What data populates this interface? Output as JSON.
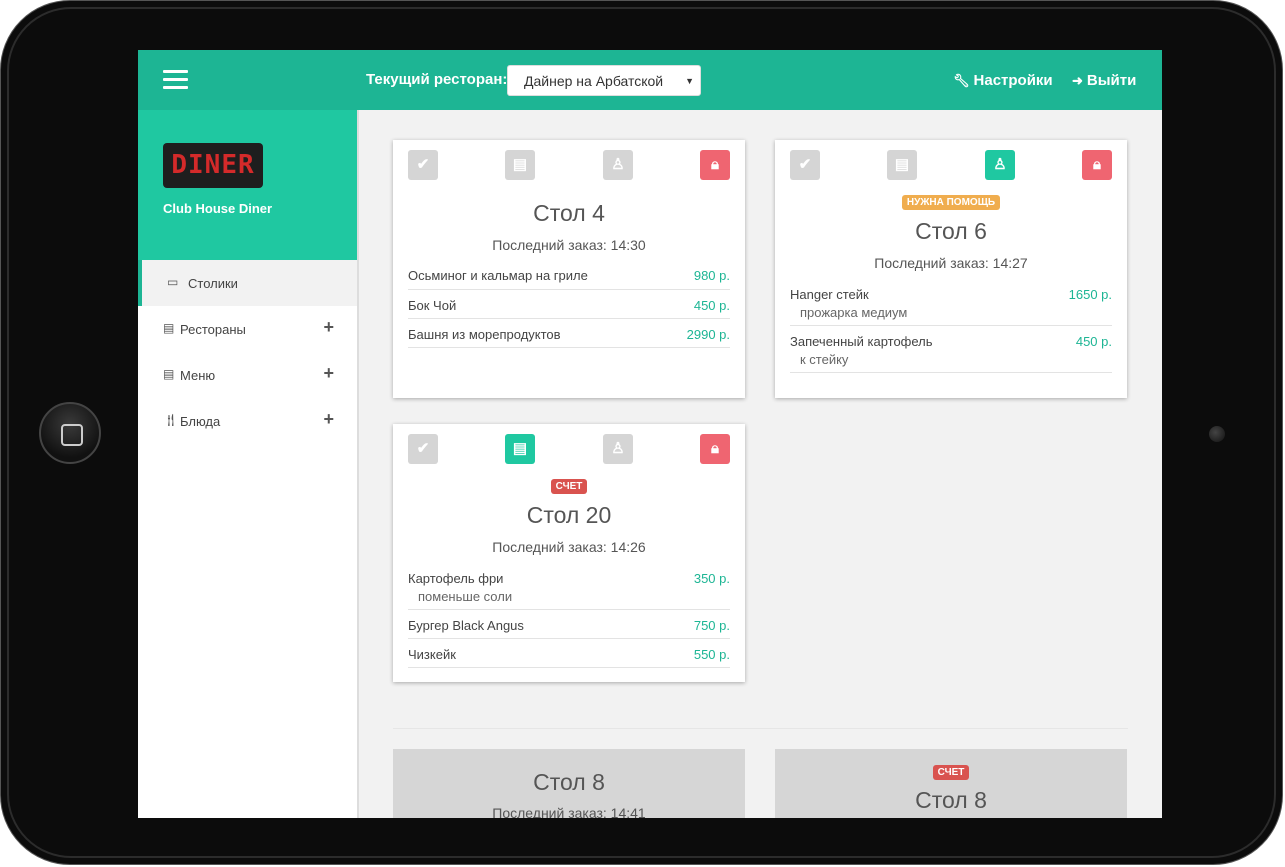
{
  "header": {
    "restaurant_label": "Текущий ресторан:",
    "restaurant_selected": "Дайнер на Арбатской",
    "settings_label": "Настройки",
    "logout_label": "Выйти"
  },
  "sidebar": {
    "logo_text": "DINER",
    "brand_name": "Club House Diner",
    "items": [
      {
        "label": "Столики"
      },
      {
        "label": "Рестораны"
      },
      {
        "label": "Меню"
      },
      {
        "label": "Блюда"
      }
    ]
  },
  "cards": [
    {
      "title": "Стол 4",
      "last_order": "Последний заказ: 14:30",
      "items": [
        {
          "name": "Осьминог и кальмар на гриле",
          "price": "980 р."
        },
        {
          "name": "Бок Чой",
          "price": "450 р."
        },
        {
          "name": "Башня из морепродуктов",
          "price": "2990 р."
        }
      ]
    },
    {
      "badge": "НУЖНА ПОМОЩЬ",
      "title": "Стол 6",
      "last_order": "Последний заказ: 14:27",
      "items": [
        {
          "name": "Hanger стейк",
          "price": "1650 р.",
          "note": "прожарка медиум"
        },
        {
          "name": "Запеченный картофель",
          "price": "450 р.",
          "note": "к стейку"
        }
      ]
    },
    {
      "badge": "СЧЕТ",
      "title": "Стол 20",
      "last_order": "Последний заказ: 14:26",
      "items": [
        {
          "name": "Картофель фри",
          "price": "350 р.",
          "note": "поменьше соли"
        },
        {
          "name": "Бургер Black Angus",
          "price": "750 р."
        },
        {
          "name": "Чизкейк",
          "price": "550 р."
        }
      ]
    }
  ],
  "closed_cards": [
    {
      "title": "Стол 8",
      "last_order": "Последний заказ: 14:41"
    },
    {
      "badge": "СЧЕТ",
      "title": "Стол 8"
    }
  ],
  "colors": {
    "accent": "#1db594",
    "brand_bg": "#1fc8a1",
    "lock_red": "#ef6571",
    "help_badge": "#f0ad4e",
    "bill_badge": "#d9534f",
    "inactive_icon": "#d5d5d5"
  },
  "icons": {
    "menu": "hamburger-menu-icon",
    "settings": "wrench-icon",
    "logout": "sign-out-icon",
    "tables": "id-card-icon",
    "restaurants": "document-icon",
    "menu_nav": "document-icon",
    "dishes": "cutlery-icon",
    "card_actions": [
      "check-icon",
      "receipt-icon",
      "waiter-icon",
      "lock-icon"
    ]
  }
}
